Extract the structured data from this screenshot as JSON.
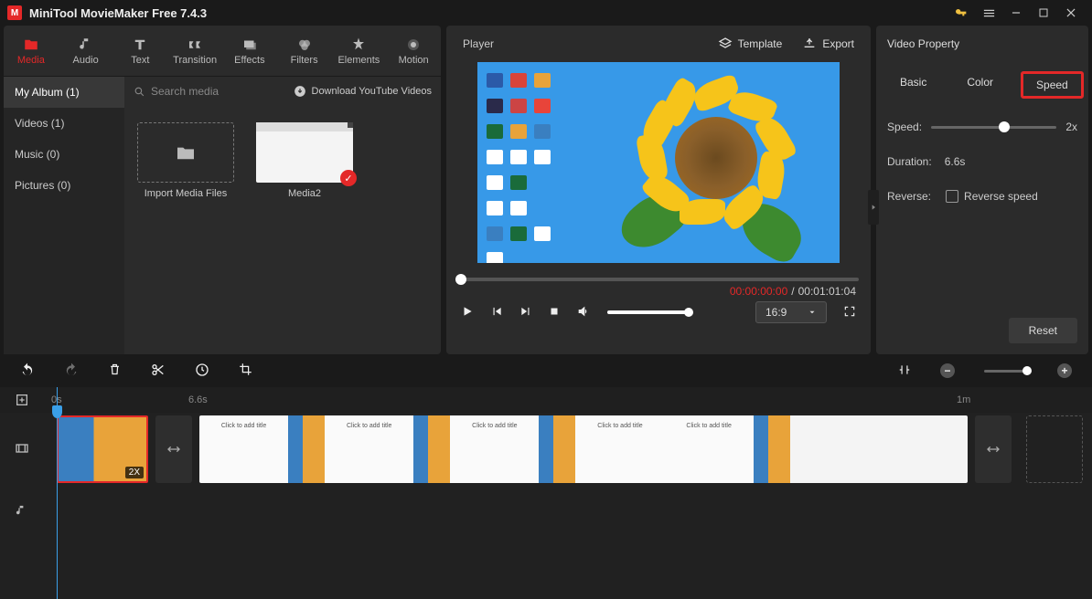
{
  "titlebar": {
    "title": "MiniTool MovieMaker Free 7.4.3"
  },
  "toolTabs": [
    {
      "label": "Media",
      "icon": "folder",
      "active": true
    },
    {
      "label": "Audio",
      "icon": "music"
    },
    {
      "label": "Text",
      "icon": "text"
    },
    {
      "label": "Transition",
      "icon": "transition"
    },
    {
      "label": "Effects",
      "icon": "effects"
    },
    {
      "label": "Filters",
      "icon": "filters"
    },
    {
      "label": "Elements",
      "icon": "elements"
    },
    {
      "label": "Motion",
      "icon": "motion"
    }
  ],
  "sidebar": {
    "items": [
      {
        "label": "My Album (1)",
        "active": true
      },
      {
        "label": "Videos (1)"
      },
      {
        "label": "Music (0)"
      },
      {
        "label": "Pictures (0)"
      }
    ]
  },
  "mediaTop": {
    "searchPlaceholder": "Search media",
    "downloadLabel": "Download YouTube Videos"
  },
  "mediaItems": {
    "importLabel": "Import Media Files",
    "item2": "Media2"
  },
  "player": {
    "title": "Player",
    "templateLabel": "Template",
    "exportLabel": "Export",
    "currentTime": "00:00:00:00",
    "totalTime": "00:01:01:04",
    "aspect": "16:9"
  },
  "property": {
    "title": "Video Property",
    "tabs": {
      "basic": "Basic",
      "color": "Color",
      "speed": "Speed"
    },
    "speedLabel": "Speed:",
    "speedValue": "2x",
    "durationLabel": "Duration:",
    "durationValue": "6.6s",
    "reverseLabel": "Reverse:",
    "reverseCheckboxLabel": "Reverse speed",
    "reset": "Reset"
  },
  "ruler": {
    "m0": "0s",
    "m1": "6.6s",
    "m2": "1m"
  },
  "clip": {
    "speedBadge": "2X",
    "docText": "Click to add title"
  }
}
